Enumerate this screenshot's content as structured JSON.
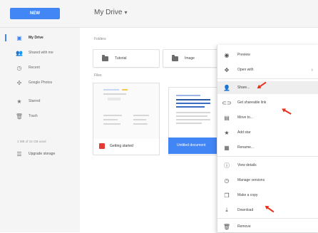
{
  "header": {
    "new_label": "NEW",
    "drive_title": "My Drive",
    "caret": "▾"
  },
  "sidebar": {
    "items": [
      {
        "label": "My Drive",
        "icon": "▣"
      },
      {
        "label": "Shared with me",
        "icon": "👥"
      },
      {
        "label": "Recent",
        "icon": "◷"
      },
      {
        "label": "Google Photos",
        "icon": "✣"
      },
      {
        "label": "Starred",
        "icon": "★"
      },
      {
        "label": "Trash",
        "icon": "🗑"
      }
    ],
    "storage": "1 MB of 15 GB used",
    "upgrade_label": "Upgrade storage",
    "upgrade_icon": "☰"
  },
  "main": {
    "folders_label": "Folders",
    "folders": [
      "Tutorial",
      "Image"
    ],
    "files_label": "Files",
    "file_name": "Getting started",
    "selected_name": "Untitled document"
  },
  "context_menu": {
    "items": [
      {
        "label": "Preview",
        "icon": "◉"
      },
      {
        "label": "Open with",
        "icon": "✥",
        "submenu": "›"
      },
      {
        "label": "Share...",
        "icon": "👤"
      },
      {
        "label": "Get shareable link",
        "icon": "⊂⊃"
      },
      {
        "label": "Move to...",
        "icon": "▤"
      },
      {
        "label": "Add star",
        "icon": "★"
      },
      {
        "label": "Rename...",
        "icon": "▦"
      },
      {
        "label": "View details",
        "icon": "ⓘ"
      },
      {
        "label": "Manage versions",
        "icon": "◷"
      },
      {
        "label": "Make a copy",
        "icon": "❐"
      },
      {
        "label": "Download",
        "icon": "⤓"
      },
      {
        "label": "Remove",
        "icon": "🗑"
      }
    ]
  },
  "colors": {
    "accent": "#4285f4",
    "annotation_arrow": "#e8311a",
    "file_icon_red": "#e53935"
  }
}
